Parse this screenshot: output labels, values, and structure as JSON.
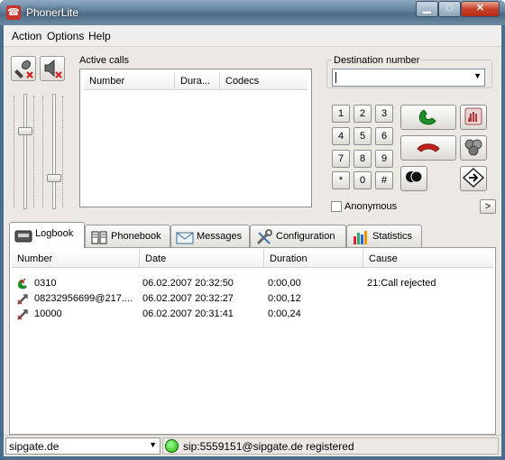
{
  "window": {
    "title": "PhonerLite",
    "min_glyph": "▁",
    "max_glyph": "□",
    "close_glyph": "✕"
  },
  "menu": [
    {
      "label": "Action"
    },
    {
      "label": "Options"
    },
    {
      "label": "Help"
    }
  ],
  "toolbar": {
    "mic_icon": "microphone-mute-icon",
    "speaker_icon": "speaker-mute-icon"
  },
  "volume": {
    "mic_level": 0.72,
    "speaker_level": 0.28
  },
  "active_calls": {
    "label": "Active calls",
    "columns": [
      "Number",
      "Dura...",
      "Codecs"
    ],
    "rows": []
  },
  "destination": {
    "label": "Destination number",
    "value": ""
  },
  "keypad": [
    "1",
    "2",
    "3",
    "4",
    "5",
    "6",
    "7",
    "8",
    "9",
    "*",
    "0",
    "#"
  ],
  "actions": {
    "dial_icon": "dial-handset-icon",
    "hangup_icon": "hangup-handset-icon",
    "hold_icon": "hand-hold-icon",
    "conference_icon": "conference-icon",
    "record_icon": "record-icon",
    "transfer_icon": "transfer-arrow-icon"
  },
  "anonymous": {
    "label": "Anonymous",
    "checked": false
  },
  "expand_button": ">",
  "tabs": [
    {
      "label": "Logbook",
      "icon": "logbook-icon",
      "active": true
    },
    {
      "label": "Phonebook",
      "icon": "phonebook-icon",
      "active": false
    },
    {
      "label": "Messages",
      "icon": "envelope-icon",
      "active": false
    },
    {
      "label": "Configuration",
      "icon": "tools-icon",
      "active": false
    },
    {
      "label": "Statistics",
      "icon": "bar-chart-icon",
      "active": false
    }
  ],
  "logbook": {
    "columns": [
      "Number",
      "Date",
      "Duration",
      "Cause"
    ],
    "rows": [
      {
        "type": "incoming",
        "number": "0310",
        "date": "06.02.2007 20:32:50",
        "duration": "0:00,00",
        "cause": "21:Call rejected"
      },
      {
        "type": "outgoing",
        "number": "08232956699@217....",
        "date": "06.02.2007 20:32:27",
        "duration": "0:00,12",
        "cause": ""
      },
      {
        "type": "outgoing",
        "number": "10000",
        "date": "06.02.2007 20:31:41",
        "duration": "0:00,24",
        "cause": ""
      }
    ]
  },
  "status": {
    "account": "sipgate.de",
    "registration": "sip:5559151@sipgate.de registered",
    "indicator_color": "#22b800"
  },
  "colors": {
    "dial_green": "#1d8f2a",
    "hangup_red": "#c2231c"
  }
}
